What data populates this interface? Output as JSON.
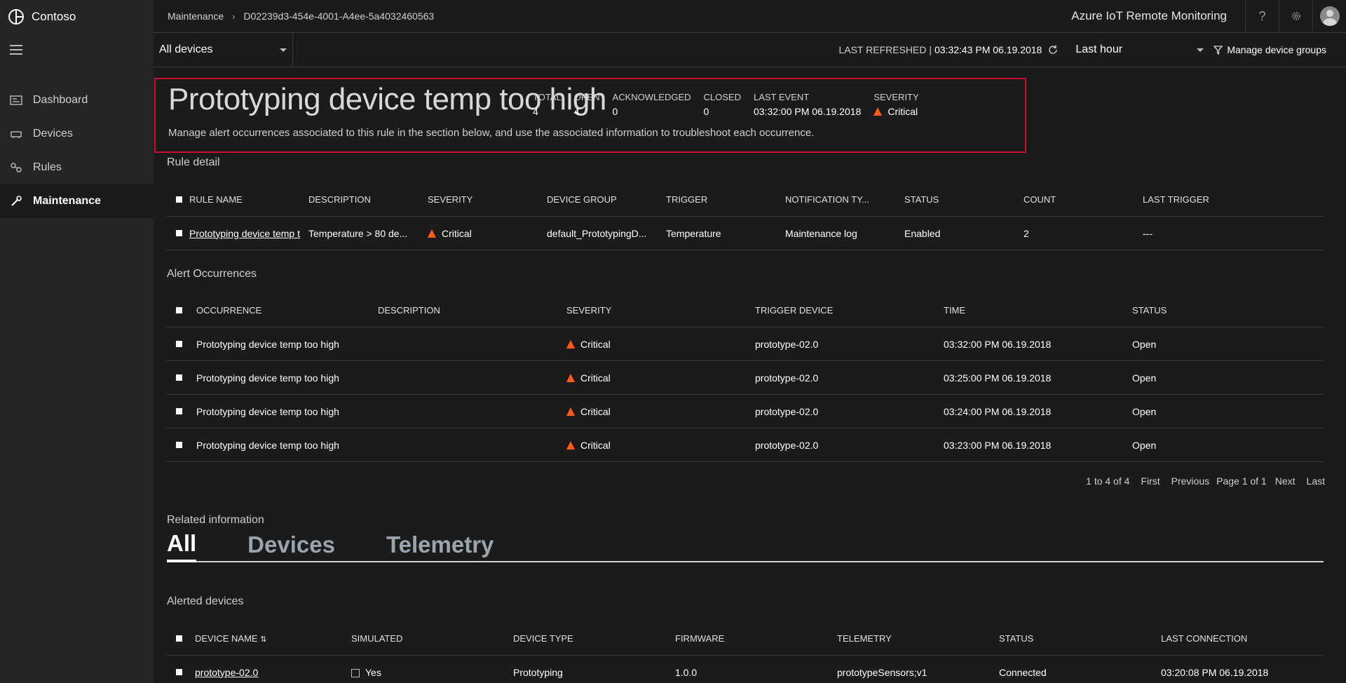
{
  "brand": {
    "name": "Contoso"
  },
  "sidebar": {
    "items": [
      {
        "label": "Dashboard",
        "icon": "dashboard-icon"
      },
      {
        "label": "Devices",
        "icon": "devices-icon"
      },
      {
        "label": "Rules",
        "icon": "rules-icon"
      },
      {
        "label": "Maintenance",
        "icon": "maintenance-icon",
        "active": true
      }
    ]
  },
  "topbar": {
    "breadcrumb": [
      "Maintenance",
      "D02239d3-454e-4001-A4ee-5a4032460563"
    ],
    "app_title": "Azure IoT Remote Monitoring"
  },
  "context": {
    "device_group": "All devices",
    "last_refreshed_label": "LAST REFRESHED |",
    "last_refreshed_value": "03:32:43 PM 06.19.2018",
    "time_range": "Last hour",
    "manage_groups": "Manage device groups"
  },
  "rule": {
    "title": "Prototyping device temp too high",
    "subtitle": "Manage alert occurrences associated to this rule in the section below, and use the associated information to troubleshoot each occurrence.",
    "stats": [
      {
        "key": "TOTAL",
        "value": "4"
      },
      {
        "key": "OPEN",
        "value": "4"
      },
      {
        "key": "ACKNOWLEDGED",
        "value": "0"
      },
      {
        "key": "CLOSED",
        "value": "0"
      },
      {
        "key": "LAST EVENT",
        "value": "03:32:00 PM 06.19.2018"
      },
      {
        "key": "SEVERITY",
        "value": "Critical"
      }
    ]
  },
  "rule_detail": {
    "label": "Rule detail",
    "headers": [
      "RULE NAME",
      "DESCRIPTION",
      "SEVERITY",
      "DEVICE GROUP",
      "TRIGGER",
      "NOTIFICATION TY...",
      "STATUS",
      "COUNT",
      "LAST TRIGGER"
    ],
    "row": [
      "Prototyping device temp t",
      "Temperature > 80 de...",
      "Critical",
      "default_PrototypingD...",
      "Temperature",
      "Maintenance log",
      "Enabled",
      "2",
      "---"
    ]
  },
  "occurrences": {
    "label": "Alert Occurrences",
    "headers": [
      "OCCURRENCE",
      "DESCRIPTION",
      "SEVERITY",
      "TRIGGER DEVICE",
      "TIME",
      "STATUS"
    ],
    "rows": [
      [
        "Prototyping device temp too high",
        "",
        "Critical",
        "prototype-02.0",
        "03:32:00 PM 06.19.2018",
        "Open"
      ],
      [
        "Prototyping device temp too high",
        "",
        "Critical",
        "prototype-02.0",
        "03:25:00 PM 06.19.2018",
        "Open"
      ],
      [
        "Prototyping device temp too high",
        "",
        "Critical",
        "prototype-02.0",
        "03:24:00 PM 06.19.2018",
        "Open"
      ],
      [
        "Prototyping device temp too high",
        "",
        "Critical",
        "prototype-02.0",
        "03:23:00 PM 06.19.2018",
        "Open"
      ]
    ],
    "pager": {
      "summary": "1 to 4 of 4",
      "first": "First",
      "previous": "Previous",
      "page": "Page 1 of 1",
      "next": "Next",
      "last": "Last"
    }
  },
  "related": {
    "label": "Related information",
    "tabs": [
      "All",
      "Devices",
      "Telemetry"
    ],
    "alerted_label": "Alerted devices",
    "headers": [
      "DEVICE NAME",
      "SIMULATED",
      "DEVICE TYPE",
      "FIRMWARE",
      "TELEMETRY",
      "STATUS",
      "LAST CONNECTION"
    ],
    "row": [
      "prototype-02.0",
      "Yes",
      "Prototyping",
      "1.0.0",
      "prototypeSensors;v1",
      "Connected",
      "03:20:08 PM 06.19.2018"
    ]
  },
  "colors": {
    "accent_red": "#c8102e",
    "critical": "#ff5a1f"
  }
}
